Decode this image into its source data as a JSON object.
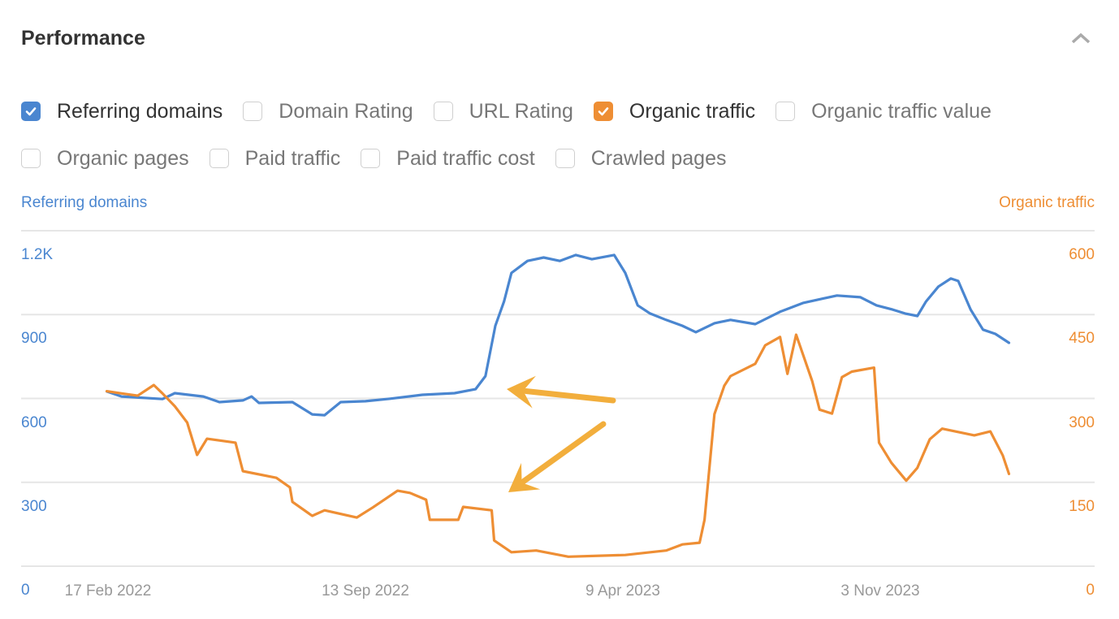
{
  "header": {
    "title": "Performance",
    "collapse_icon": "chevron-up-icon"
  },
  "metrics": [
    [
      {
        "label": "Referring domains",
        "checked": true,
        "color": "#4a86d0"
      },
      {
        "label": "Domain Rating",
        "checked": false
      },
      {
        "label": "URL Rating",
        "checked": false
      },
      {
        "label": "Organic traffic",
        "checked": true,
        "color": "#ee8e34"
      },
      {
        "label": "Organic traffic value",
        "checked": false
      }
    ],
    [
      {
        "label": "Organic pages",
        "checked": false
      },
      {
        "label": "Paid traffic",
        "checked": false
      },
      {
        "label": "Paid traffic cost",
        "checked": false
      },
      {
        "label": "Crawled pages",
        "checked": false
      }
    ]
  ],
  "chart_data": {
    "type": "line",
    "title": "",
    "grid": true,
    "x_unit": "days since 17 Feb 2022",
    "xlim": [
      -1,
      728
    ],
    "x_ticks": [
      {
        "day": 0,
        "label": "17 Feb 2022"
      },
      {
        "day": 208,
        "label": "13 Sep 2022"
      },
      {
        "day": 416,
        "label": "9 Apr 2023"
      },
      {
        "day": 624,
        "label": "3 Nov 2023"
      }
    ],
    "y_left": {
      "label": "Referring domains",
      "color": "#4a86d0",
      "ylim": [
        0,
        1200
      ],
      "ticks": [
        {
          "v": 0,
          "label": "0"
        },
        {
          "v": 300,
          "label": "300"
        },
        {
          "v": 600,
          "label": "600"
        },
        {
          "v": 900,
          "label": "900"
        },
        {
          "v": 1200,
          "label": "1.2K"
        }
      ]
    },
    "y_right": {
      "label": "Organic traffic",
      "color": "#ee8e34",
      "ylim": [
        0,
        600
      ],
      "ticks": [
        {
          "v": 0,
          "label": "0"
        },
        {
          "v": 150,
          "label": "150"
        },
        {
          "v": 300,
          "label": "300"
        },
        {
          "v": 450,
          "label": "450"
        },
        {
          "v": 600,
          "label": "600"
        }
      ]
    },
    "series": [
      {
        "name": "Referring domains",
        "axis": "left",
        "color": "#4a86d0",
        "points": [
          [
            -1,
            625
          ],
          [
            11,
            607
          ],
          [
            44,
            598
          ],
          [
            54,
            619
          ],
          [
            77,
            607
          ],
          [
            90,
            587
          ],
          [
            109,
            593
          ],
          [
            116,
            607
          ],
          [
            122,
            584
          ],
          [
            149,
            587
          ],
          [
            165,
            543
          ],
          [
            175,
            540
          ],
          [
            188,
            587
          ],
          [
            208,
            590
          ],
          [
            228,
            599
          ],
          [
            254,
            613
          ],
          [
            280,
            619
          ],
          [
            297,
            633
          ],
          [
            305,
            680
          ],
          [
            313,
            860
          ],
          [
            320,
            947
          ],
          [
            326,
            1049
          ],
          [
            339,
            1092
          ],
          [
            352,
            1104
          ],
          [
            365,
            1092
          ],
          [
            378,
            1113
          ],
          [
            391,
            1098
          ],
          [
            409,
            1113
          ],
          [
            418,
            1049
          ],
          [
            428,
            933
          ],
          [
            438,
            904
          ],
          [
            451,
            881
          ],
          [
            464,
            860
          ],
          [
            475,
            837
          ],
          [
            490,
            869
          ],
          [
            503,
            881
          ],
          [
            523,
            866
          ],
          [
            543,
            910
          ],
          [
            562,
            942
          ],
          [
            589,
            968
          ],
          [
            608,
            962
          ],
          [
            621,
            933
          ],
          [
            634,
            918
          ],
          [
            644,
            904
          ],
          [
            654,
            895
          ],
          [
            661,
            947
          ],
          [
            671,
            1000
          ],
          [
            681,
            1029
          ],
          [
            687,
            1020
          ],
          [
            697,
            918
          ],
          [
            707,
            846
          ],
          [
            717,
            831
          ],
          [
            728,
            799
          ]
        ]
      },
      {
        "name": "Organic traffic",
        "axis": "right",
        "color": "#ee8e34",
        "points": [
          [
            -1,
            313
          ],
          [
            11,
            309
          ],
          [
            24,
            305
          ],
          [
            37,
            324
          ],
          [
            44,
            309
          ],
          [
            54,
            286
          ],
          [
            64,
            257
          ],
          [
            72,
            199
          ],
          [
            80,
            228
          ],
          [
            103,
            221
          ],
          [
            109,
            170
          ],
          [
            136,
            158
          ],
          [
            147,
            141
          ],
          [
            149,
            115
          ],
          [
            165,
            90
          ],
          [
            175,
            100
          ],
          [
            201,
            87
          ],
          [
            214,
            105
          ],
          [
            234,
            135
          ],
          [
            244,
            131
          ],
          [
            257,
            119
          ],
          [
            260,
            83
          ],
          [
            283,
            83
          ],
          [
            287,
            106
          ],
          [
            310,
            100
          ],
          [
            312,
            46
          ],
          [
            326,
            25
          ],
          [
            346,
            28
          ],
          [
            372,
            17
          ],
          [
            418,
            20
          ],
          [
            451,
            28
          ],
          [
            464,
            39
          ],
          [
            478,
            42
          ],
          [
            482,
            83
          ],
          [
            490,
            272
          ],
          [
            498,
            323
          ],
          [
            503,
            340
          ],
          [
            523,
            362
          ],
          [
            531,
            395
          ],
          [
            543,
            410
          ],
          [
            549,
            344
          ],
          [
            556,
            414
          ],
          [
            569,
            331
          ],
          [
            575,
            280
          ],
          [
            585,
            273
          ],
          [
            593,
            338
          ],
          [
            601,
            348
          ],
          [
            619,
            355
          ],
          [
            623,
            221
          ],
          [
            633,
            185
          ],
          [
            645,
            153
          ],
          [
            654,
            176
          ],
          [
            664,
            227
          ],
          [
            674,
            246
          ],
          [
            700,
            234
          ],
          [
            713,
            241
          ],
          [
            723,
            198
          ],
          [
            728,
            165
          ]
        ]
      }
    ],
    "annotations": [
      {
        "type": "arrow",
        "color": "#f2ae3c",
        "description": "points to referring domains sharp rise"
      },
      {
        "type": "arrow",
        "color": "#f2ae3c",
        "description": "points to organic traffic drop"
      }
    ]
  }
}
